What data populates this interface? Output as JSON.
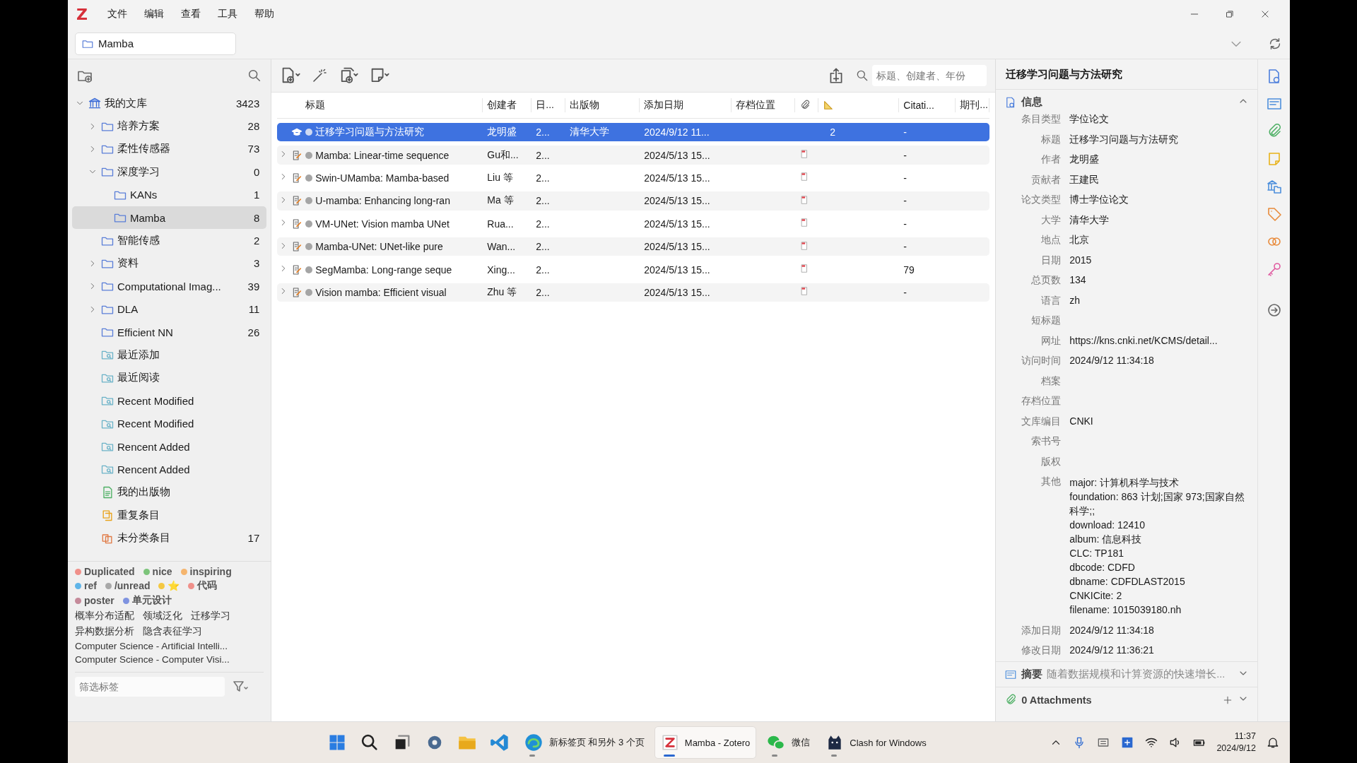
{
  "logo": "Z",
  "menu": [
    "文件",
    "编辑",
    "查看",
    "工具",
    "帮助"
  ],
  "location": {
    "label": "Mamba"
  },
  "tree": [
    {
      "kind": "library",
      "label": "我的文库",
      "count": "3423",
      "expanded": true,
      "selected": false,
      "children": [
        {
          "kind": "folder",
          "label": "培养方案",
          "count": "28",
          "expanded": false,
          "selected": false
        },
        {
          "kind": "folder",
          "label": "柔性传感器",
          "count": "73",
          "expanded": false,
          "selected": false
        },
        {
          "kind": "folder",
          "label": "深度学习",
          "count": "0",
          "expanded": true,
          "selected": false,
          "children": [
            {
              "kind": "folder",
              "label": "KANs",
              "count": "1",
              "selected": false
            },
            {
              "kind": "folder",
              "label": "Mamba",
              "count": "8",
              "selected": true
            }
          ]
        },
        {
          "kind": "folder",
          "label": "智能传感",
          "count": "2",
          "selected": false
        },
        {
          "kind": "folder",
          "label": "资料",
          "count": "3",
          "expanded": false,
          "selected": false
        },
        {
          "kind": "folder",
          "label": "Computational Imag...",
          "count": "39",
          "expanded": false,
          "selected": false
        },
        {
          "kind": "folder",
          "label": "DLA",
          "count": "11",
          "expanded": false,
          "selected": false
        },
        {
          "kind": "folder",
          "label": "Efficient NN",
          "count": "26",
          "selected": false
        },
        {
          "kind": "search",
          "label": "最近添加",
          "selected": false
        },
        {
          "kind": "search",
          "label": "最近阅读",
          "selected": false
        },
        {
          "kind": "search",
          "label": "Recent Modified",
          "selected": false
        },
        {
          "kind": "search",
          "label": "Recent Modified",
          "selected": false
        },
        {
          "kind": "search",
          "label": "Rencent Added",
          "selected": false
        },
        {
          "kind": "search",
          "label": "Rencent Added",
          "selected": false
        },
        {
          "kind": "publications",
          "label": "我的出版物",
          "selected": false
        },
        {
          "kind": "duplicates",
          "label": "重复条目",
          "selected": false
        },
        {
          "kind": "unfiled",
          "label": "未分类条目",
          "count": "17",
          "selected": false
        }
      ]
    }
  ],
  "colored_tags": [
    {
      "label": "Duplicated",
      "color": "#f0908a"
    },
    {
      "label": "nice",
      "color": "#7cc47a"
    },
    {
      "label": "inspiring",
      "color": "#f5b56e"
    },
    {
      "label": "ref",
      "color": "#5fb4e8"
    },
    {
      "label": "/unread",
      "color": "#a8a8a8"
    },
    {
      "label": "⭐",
      "color": "#f4c842"
    },
    {
      "label": "代码",
      "color": "#f0908a"
    },
    {
      "label": "poster",
      "color": "#c58a9a"
    },
    {
      "label": "单元设计",
      "color": "#7f93e0"
    }
  ],
  "tags": [
    "概率分布适配",
    "领域泛化",
    "迁移学习",
    "异构数据分析",
    "隐含表征学习",
    "Computer Science - Artificial Intelli...",
    "Computer Science - Computer Visi..."
  ],
  "tag_filter": {
    "placeholder": "筛选标签"
  },
  "search": {
    "placeholder": "标题、创建者、年份"
  },
  "table": {
    "columns": [
      {
        "label": "标题"
      },
      {
        "label": "创建者"
      },
      {
        "label": "日..."
      },
      {
        "label": "出版物"
      },
      {
        "label": "添加日期"
      },
      {
        "label": "存档位置"
      },
      {
        "kind": "attachments"
      },
      {
        "kind": "ruler"
      },
      {
        "label": "Citati..."
      },
      {
        "label": "期刊..."
      }
    ],
    "rows": [
      {
        "kind": "thesis",
        "selected": true,
        "title": "迁移学习问题与方法研究",
        "creator": "龙明盛",
        "date": "2...",
        "publication": "清华大学",
        "added": "2024/9/12 11...",
        "pdf": false,
        "column_8": "2",
        "citations": "-"
      },
      {
        "kind": "preprint",
        "expanded": false,
        "selected": false,
        "title": "Mamba: Linear-time sequence",
        "creator": "Gu和...",
        "date": "2...",
        "added": "2024/5/13 15...",
        "pdf": true,
        "citations": "-"
      },
      {
        "kind": "preprint",
        "expanded": false,
        "selected": false,
        "title": "Swin-UMamba: Mamba-based",
        "creator": "Liu 等",
        "date": "2...",
        "added": "2024/5/13 15...",
        "pdf": true,
        "citations": "-"
      },
      {
        "kind": "preprint",
        "expanded": false,
        "selected": false,
        "title": "U-mamba: Enhancing long-ran",
        "creator": "Ma 等",
        "date": "2...",
        "added": "2024/5/13 15...",
        "pdf": true,
        "citations": "-"
      },
      {
        "kind": "preprint",
        "expanded": false,
        "selected": false,
        "title": "VM-UNet: Vision mamba UNet",
        "creator": "Rua...",
        "date": "2...",
        "added": "2024/5/13 15...",
        "pdf": true,
        "citations": "-"
      },
      {
        "kind": "preprint",
        "expanded": false,
        "selected": false,
        "title": "Mamba-UNet: UNet-like pure",
        "creator": "Wan...",
        "date": "2...",
        "added": "2024/5/13 15...",
        "pdf": true,
        "citations": "-"
      },
      {
        "kind": "preprint",
        "expanded": false,
        "selected": false,
        "title": "SegMamba: Long-range seque",
        "creator": "Xing...",
        "date": "2...",
        "added": "2024/5/13 15...",
        "pdf": true,
        "citations": "79"
      },
      {
        "kind": "preprint",
        "expanded": false,
        "selected": false,
        "title": "Vision mamba: Efficient visual",
        "creator": "Zhu 等",
        "date": "2...",
        "added": "2024/5/13 15...",
        "pdf": true,
        "citations": "-"
      }
    ]
  },
  "item_pane": {
    "title": "迁移学习问题与方法研究",
    "info": {
      "heading": "信息",
      "expanded": true,
      "fields": [
        {
          "label": "条目类型",
          "value": "学位论文"
        },
        {
          "label": "标题",
          "value": "迁移学习问题与方法研究"
        },
        {
          "label": "作者",
          "value": "龙明盛"
        },
        {
          "label": "贡献者",
          "value": "王建民"
        },
        {
          "label": "论文类型",
          "value": "博士学位论文"
        },
        {
          "label": "大学",
          "value": "清华大学"
        },
        {
          "label": "地点",
          "value": "北京"
        },
        {
          "label": "日期",
          "value": "2015"
        },
        {
          "label": "总页数",
          "value": "134"
        },
        {
          "label": "语言",
          "value": "zh"
        },
        {
          "label": "短标题"
        },
        {
          "label": "网址",
          "value": "https://kns.cnki.net/KCMS/detail..."
        },
        {
          "label": "访问时间",
          "value": "2024/9/12 11:34:18"
        },
        {
          "label": "档案"
        },
        {
          "label": "存档位置"
        },
        {
          "label": "文库编目",
          "value": "CNKI"
        },
        {
          "label": "索书号"
        },
        {
          "label": "版权"
        },
        {
          "label": "其他",
          "lines": [
            "major: 计算机科学与技术",
            "foundation: 863 计划;国家 973;国家自然科学;;",
            "download: 12410",
            "album: 信息科技",
            "CLC: TP181",
            "dbcode: CDFD",
            "dbname: CDFDLAST2015",
            "CNKICite: 2",
            "filename: 1015039180.nh"
          ]
        },
        {
          "label": "添加日期",
          "value": "2024/9/12 11:34:18"
        },
        {
          "label": "修改日期",
          "value": "2024/9/12 11:36:21"
        }
      ]
    },
    "abstract": {
      "heading": "摘要",
      "preview": "随着数据规模和计算资源的快速增长...",
      "expanded": false
    },
    "attachments": {
      "heading": "0 Attachments",
      "expanded": false
    }
  },
  "taskbar": {
    "apps": [
      {
        "kind": "start"
      },
      {
        "kind": "search"
      },
      {
        "kind": "taskview"
      },
      {
        "kind": "settings"
      },
      {
        "kind": "files"
      },
      {
        "kind": "vscode"
      },
      {
        "kind": "edge",
        "label": "新标签页 和另外 3 个页",
        "running": true,
        "selected": false
      },
      {
        "kind": "zotero",
        "label": "Mamba - Zotero",
        "running": true,
        "selected": true
      },
      {
        "kind": "wechat",
        "label": "微信",
        "running": true,
        "selected": false
      },
      {
        "kind": "clash",
        "label": "Clash for Windows",
        "running": true,
        "selected": false
      }
    ],
    "time": "11:37",
    "date": "2024/9/12"
  }
}
